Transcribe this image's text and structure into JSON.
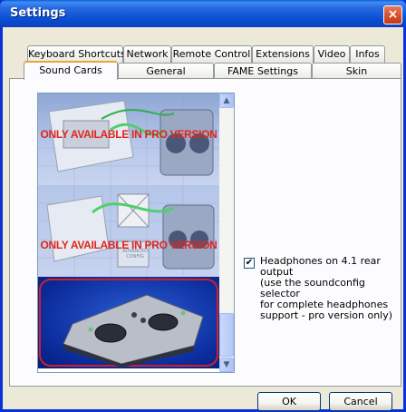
{
  "window": {
    "title": "Settings",
    "close_glyph": "×"
  },
  "tabs_row1": [
    "Keyboard Shortcuts",
    "Network",
    "Remote Control",
    "Extensions",
    "Video",
    "Infos"
  ],
  "tabs_row2": [
    "Sound Cards",
    "General",
    "FAME Settings",
    "Skin"
  ],
  "active_tab": "Sound Cards",
  "sound_cards": {
    "items": [
      {
        "label": "ONLY AVAILABLE IN PRO VERSION",
        "selected": false
      },
      {
        "label": "ONLY AVAILABLE IN PRO VERSION",
        "sub_label": "ADVANCED CONFIG",
        "selected": false
      },
      {
        "label": "",
        "selected": true
      }
    ],
    "scroll_up_glyph": "▲",
    "scroll_down_glyph": "▼"
  },
  "headphones": {
    "checked": true,
    "check_glyph": "✔",
    "line1": "Headphones on 4.1 rear output",
    "line2": "(use the soundconfig selector",
    "line3": "for complete headphones",
    "line4": "support - pro version only)"
  },
  "buttons": {
    "ok": "OK",
    "cancel": "Cancel"
  },
  "colors": {
    "titlebar": "#0a4fd4",
    "pro_label": "#e0251c",
    "selection_outline": "#d21f26",
    "tab_highlight": "#e7a53a"
  },
  "icons": [
    "close-icon",
    "scroll-up-icon",
    "scroll-down-icon",
    "check-icon"
  ]
}
